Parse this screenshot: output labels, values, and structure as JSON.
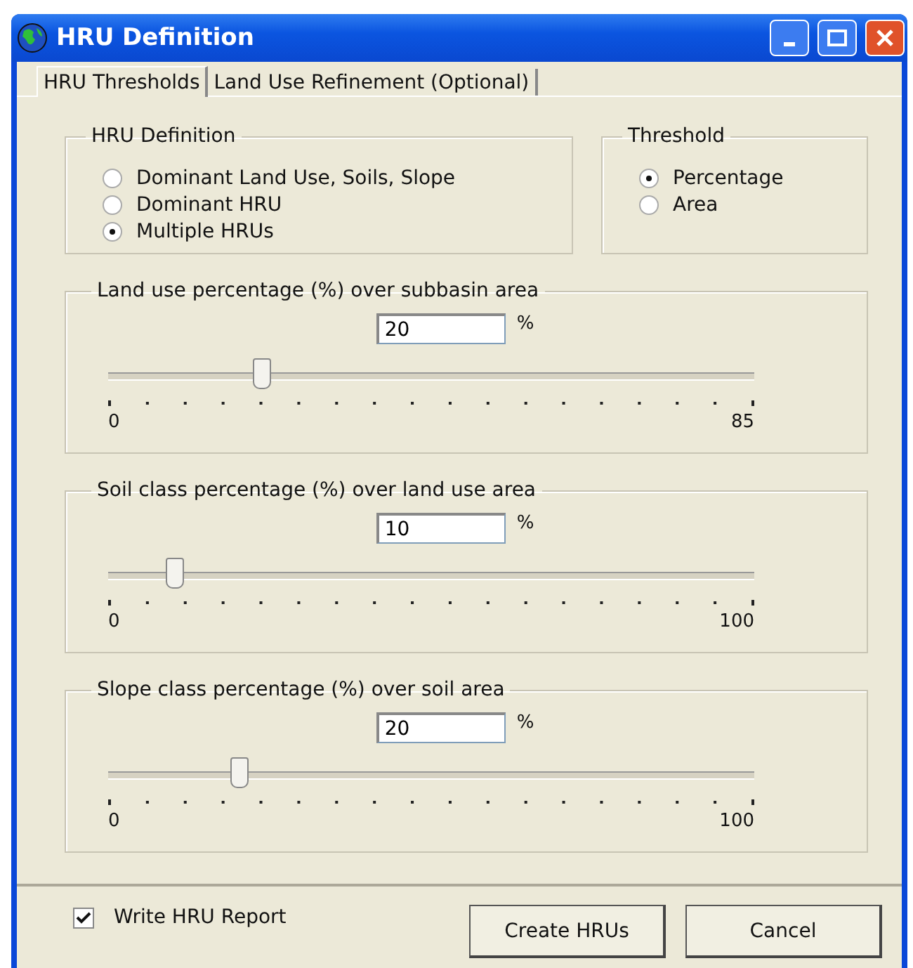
{
  "window": {
    "title": "HRU Definition"
  },
  "tabs": [
    {
      "label": "HRU Thresholds",
      "selected": true
    },
    {
      "label": "Land Use Refinement (Optional)",
      "selected": false
    }
  ],
  "hru_definition": {
    "title": "HRU Definition",
    "options": [
      {
        "label": "Dominant Land Use, Soils, Slope",
        "selected": false
      },
      {
        "label": "Dominant HRU",
        "selected": false
      },
      {
        "label": "Multiple HRUs",
        "selected": true
      }
    ]
  },
  "threshold": {
    "title": "Threshold",
    "options": [
      {
        "label": "Percentage",
        "selected": true
      },
      {
        "label": "Area",
        "selected": false
      }
    ]
  },
  "sliders": [
    {
      "title": "Land use percentage (%) over subbasin area",
      "value": "20",
      "unit": "%",
      "level": 0.235,
      "min": "0",
      "max": "85"
    },
    {
      "title": "Soil class percentage (%) over land use area",
      "value": "10",
      "unit": "%",
      "level": 0.1,
      "min": "0",
      "max": "100"
    },
    {
      "title": "Slope class percentage (%) over soil area",
      "value": "20",
      "unit": "%",
      "level": 0.2,
      "min": "0",
      "max": "100"
    }
  ],
  "report": {
    "label": "Write HRU Report",
    "checked": true
  },
  "buttons": [
    "Create HRUs",
    "Cancel"
  ]
}
